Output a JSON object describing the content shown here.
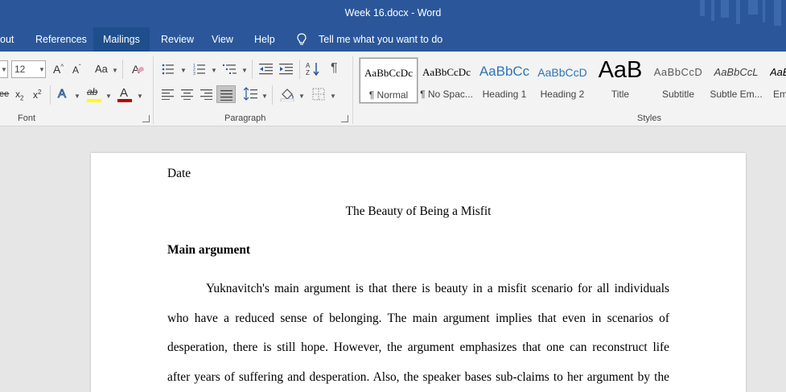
{
  "window": {
    "title": "Week 16.docx  -  Word"
  },
  "tabs": [
    {
      "label": "out"
    },
    {
      "label": "References"
    },
    {
      "label": "Mailings"
    },
    {
      "label": "Review"
    },
    {
      "label": "View"
    },
    {
      "label": "Help"
    }
  ],
  "active_tab": "Mailings",
  "tell_me": "Tell me what you want to do",
  "font_group": {
    "label": "Font",
    "size": "12",
    "grow_label": "A",
    "shrink_label": "A",
    "change_case": "Aa",
    "subscript": "x",
    "superscript": "x",
    "sub_digit": "2",
    "sup_digit": "2",
    "strike_fragment": "ee",
    "highlight_label": "ab",
    "font_color_label": "A",
    "text_effects_label": "A",
    "colors": {
      "highlight": "#ffff00",
      "font_color": "#c00000",
      "accent": "#2b579a"
    }
  },
  "paragraph_group": {
    "label": "Paragraph",
    "pilcrow": "¶"
  },
  "styles_group": {
    "label": "Styles",
    "items": [
      {
        "preview": "AaBbCcDc",
        "name": "¶ Normal",
        "selected": true
      },
      {
        "preview": "AaBbCcDc",
        "name": "¶ No Spac..."
      },
      {
        "preview": "AaBbCc",
        "name": "Heading 1"
      },
      {
        "preview": "AaBbCcD",
        "name": "Heading 2"
      },
      {
        "preview": "AaB",
        "name": "Title"
      },
      {
        "preview": "AaBbCcD",
        "name": "Subtitle"
      },
      {
        "preview": "AaBbCcL",
        "name": "Subtle Em..."
      },
      {
        "preview": "AaBl",
        "name": "Em"
      }
    ]
  },
  "document": {
    "date": "Date",
    "title": "The Beauty of Being a Misfit",
    "heading": "Main argument",
    "lines": [
      "Yuknavitch's main argument is that there is beauty in a misfit scenario for all individuals",
      "who have a reduced sense of belonging. The main argument implies that even in scenarios of",
      "desperation, there is still hope. However, the argument emphasizes that one can reconstruct life",
      "after years of suffering and desperation. Also, the speaker bases sub-claims to her argument by the"
    ]
  }
}
